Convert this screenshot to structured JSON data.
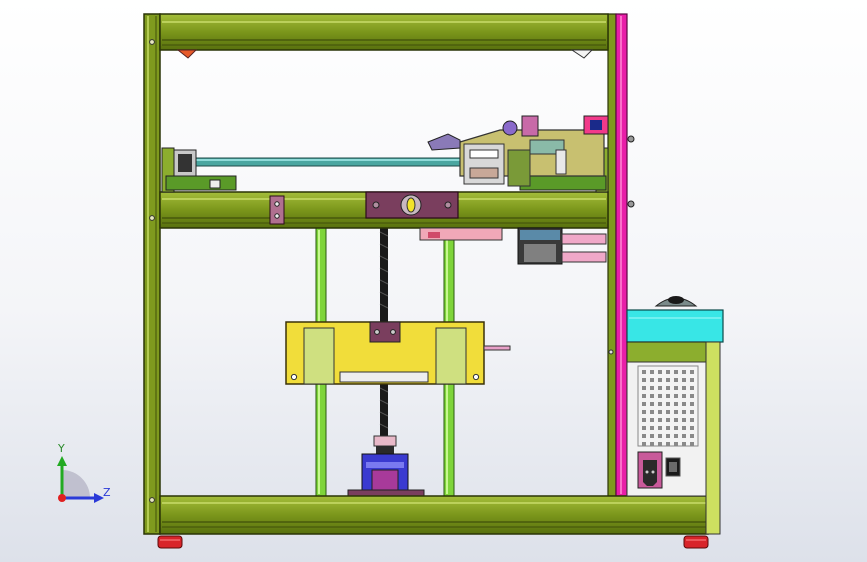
{
  "axes": {
    "y_label": "Y",
    "z_label": "Z"
  },
  "colors": {
    "extrusion": "#7f9a1e",
    "extrusion_dark": "#40500a",
    "extrusion_light": "#b4cc52",
    "pink_frame": "#e81ea8",
    "rod": "#7ed43a",
    "lead_screw": "#1a1a1a",
    "carriage": "#f1dd3a",
    "enclosure": "#38e6e6",
    "feet": "#d8242a",
    "coupler": "#3a3ad0",
    "clamp": "#7a3e5e"
  },
  "icons": [
    "triad-icon",
    "power-socket-icon",
    "rocker-switch-icon"
  ]
}
